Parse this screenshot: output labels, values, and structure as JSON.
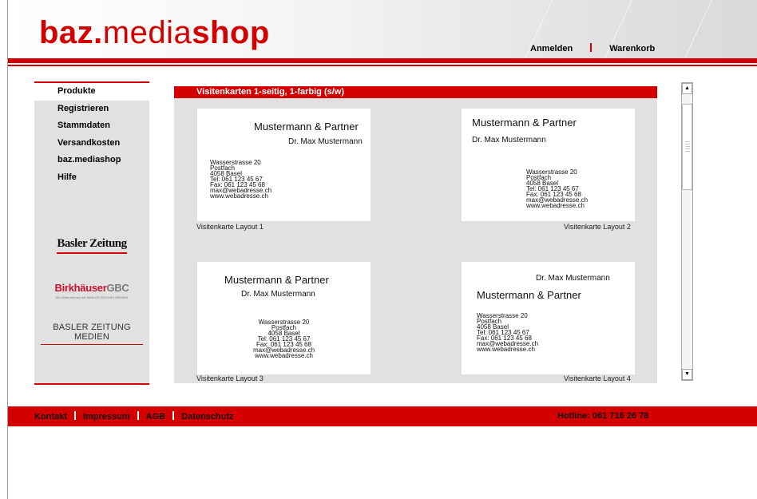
{
  "brand": {
    "logo_part1": "baz.",
    "logo_part2": "media",
    "logo_part3": "shop"
  },
  "topnav": {
    "login": "Anmelden",
    "cart": "Warenkorb"
  },
  "sidebar": {
    "items": [
      {
        "label": "Produkte"
      },
      {
        "label": "Registrieren"
      },
      {
        "label": "Stammdaten"
      },
      {
        "label": "Versandkosten"
      },
      {
        "label": "baz.mediashop"
      },
      {
        "label": "Hilfe"
      }
    ],
    "partners": {
      "bz": "Basler Zeitung",
      "bgbc_a": "Birkhäuser",
      "bgbc_b": "GBC",
      "bgbc_sub": "Ein Unternehmen der BASLER ZEITUNG MEDIEN",
      "bzm": "BASLER ZEITUNG MEDIEN"
    }
  },
  "content": {
    "title": "Visitenkarten 1-seitig, 1-farbig (s/w)",
    "cards": [
      {
        "caption": "Visitenkarte Layout 1",
        "firm": "Mustermann & Partner",
        "name": "Dr. Max Mustermann",
        "address": [
          "Wasserstrasse 20",
          "Postfach",
          "4058 Basel",
          "Tel: 061 123 45 67",
          "Fax: 061 123 45 68",
          "max@webadresse.ch",
          "www.webadresse.ch"
        ]
      },
      {
        "caption": "Visitenkarte Layout 2",
        "firm": "Mustermann & Partner",
        "name": "Dr. Max Mustermann",
        "address": [
          "Wasserstrasse 20",
          "Postfach",
          "4058 Basel",
          "Tel: 061 123 45 67",
          "Fax: 061 123 45 68",
          "max@webadresse.ch",
          "www.webadresse.ch"
        ]
      },
      {
        "caption": "Visitenkarte Layout 3",
        "firm": "Mustermann & Partner",
        "name": "Dr. Max Mustermann",
        "address": [
          "Wasserstrasse 20",
          "Postfach",
          "4058 Basel",
          "Tel: 061 123 45 67",
          "Fax: 061 123 45 68",
          "max@webadresse.ch",
          "www.webadresse.ch"
        ]
      },
      {
        "caption": "Visitenkarte Layout 4",
        "firm": "Mustermann & Partner",
        "name": "Dr. Max Mustermann",
        "address": [
          "Wasserstrasse 20",
          "Postfach",
          "4058 Basel",
          "Tel: 061 123 45 67",
          "Fax: 061 123 45 68",
          "max@webadresse.ch",
          "www.webadresse.ch"
        ]
      }
    ]
  },
  "scrollbar": {
    "up": "▲",
    "down": "▼"
  },
  "footer": {
    "kontakt": "Kontakt",
    "impressum": "Impressum",
    "agb": "AGB",
    "datenschutz": "Datenschutz",
    "hotline": "Hotline: 061 716 26 78"
  },
  "colors": {
    "accent": "#d40000",
    "panel": "#e1e1e1"
  }
}
